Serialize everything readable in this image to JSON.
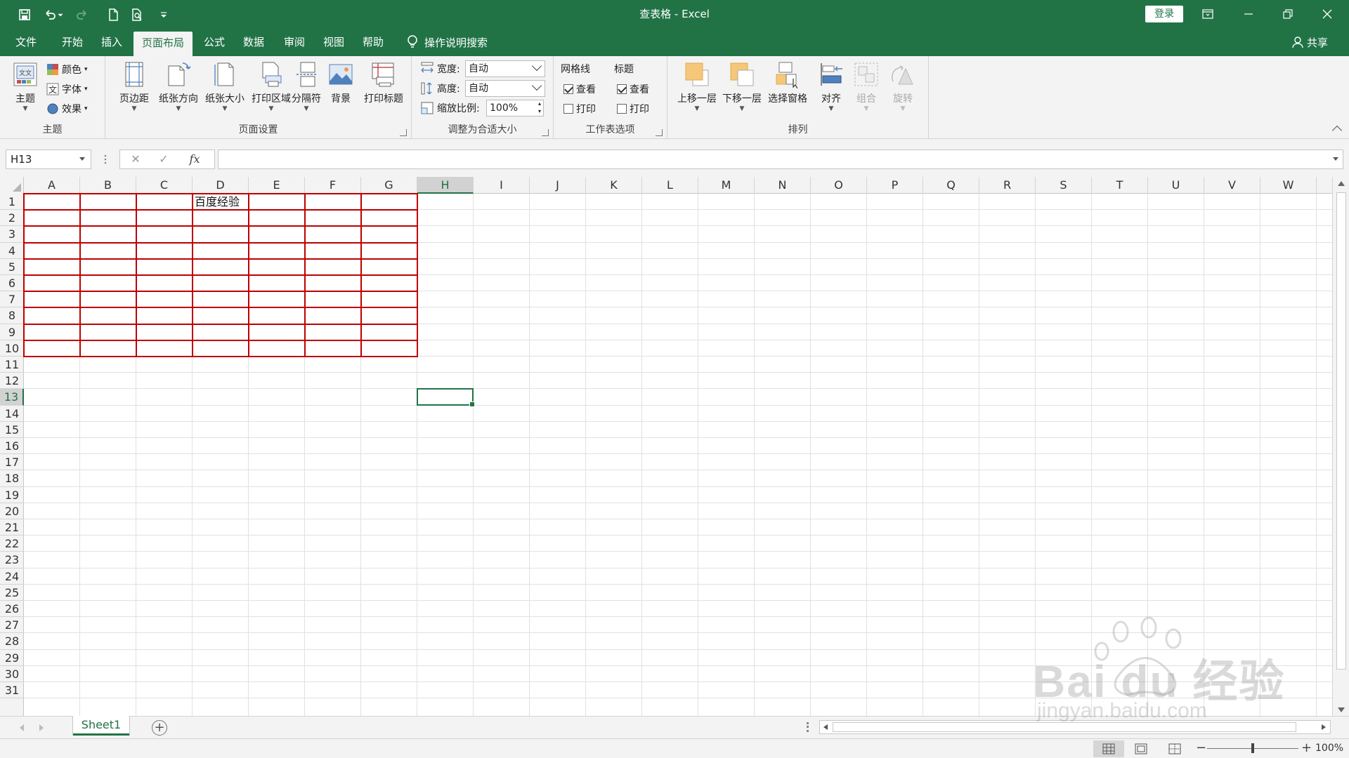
{
  "window": {
    "title": "查表格  -  Excel",
    "login_label": "登录"
  },
  "tabs": [
    {
      "label": "文件"
    },
    {
      "label": "开始"
    },
    {
      "label": "插入"
    },
    {
      "label": "页面布局"
    },
    {
      "label": "公式"
    },
    {
      "label": "数据"
    },
    {
      "label": "审阅"
    },
    {
      "label": "视图"
    },
    {
      "label": "帮助"
    }
  ],
  "active_tab": "页面布局",
  "search_label": "操作说明搜索",
  "share_label": "共享",
  "ribbon": {
    "themes": {
      "group_label": "主题",
      "theme_btn": "主题",
      "colors": "颜色",
      "fonts": "字体",
      "effects": "效果"
    },
    "page_setup": {
      "group_label": "页面设置",
      "margins": "页边距",
      "orientation": "纸张方向",
      "size": "纸张大小",
      "print_area": "打印区域",
      "breaks": "分隔符",
      "background": "背景",
      "print_titles": "打印标题"
    },
    "scale": {
      "group_label": "调整为合适大小",
      "width_label": "宽度:",
      "width_value": "自动",
      "height_label": "高度:",
      "height_value": "自动",
      "scale_label": "缩放比例:",
      "scale_value": "100%"
    },
    "sheet_options": {
      "group_label": "工作表选项",
      "gridlines_title": "网格线",
      "headings_title": "标题",
      "view_label": "查看",
      "print_label": "打印",
      "gridlines_view": true,
      "gridlines_print": false,
      "headings_view": true,
      "headings_print": false
    },
    "arrange": {
      "group_label": "排列",
      "bring_forward": "上移一层",
      "send_backward": "下移一层",
      "selection_pane": "选择窗格",
      "align": "对齐",
      "group": "组合",
      "rotate": "旋转"
    }
  },
  "formula_bar": {
    "name_box": "H13",
    "fx_label": "fx",
    "formula": ""
  },
  "sheet": {
    "columns": [
      "A",
      "B",
      "C",
      "D",
      "E",
      "F",
      "G",
      "H",
      "I",
      "J",
      "K",
      "L",
      "M",
      "N",
      "O",
      "P",
      "Q",
      "R",
      "S",
      "T",
      "U",
      "V",
      "W"
    ],
    "rows": [
      "1",
      "2",
      "3",
      "4",
      "5",
      "6",
      "7",
      "8",
      "9",
      "10",
      "11",
      "12",
      "13",
      "14",
      "15",
      "16",
      "17",
      "18",
      "19",
      "20",
      "21",
      "22",
      "23",
      "24",
      "25",
      "26",
      "27",
      "28",
      "29",
      "30",
      "31"
    ],
    "selected_column": "H",
    "selected_row": "13",
    "cell_D1": "百度经验",
    "bordered_range": "A1:G10",
    "border_color": "#c00000"
  },
  "sheet_tabs": [
    {
      "label": "Sheet1"
    }
  ],
  "status": {
    "zoom_level": "100%",
    "zoom_fraction": 0.5
  },
  "watermark": {
    "text": "Bai du 经验",
    "sub": "jingyan.baidu.com"
  },
  "colors": {
    "accent": "#217346"
  }
}
